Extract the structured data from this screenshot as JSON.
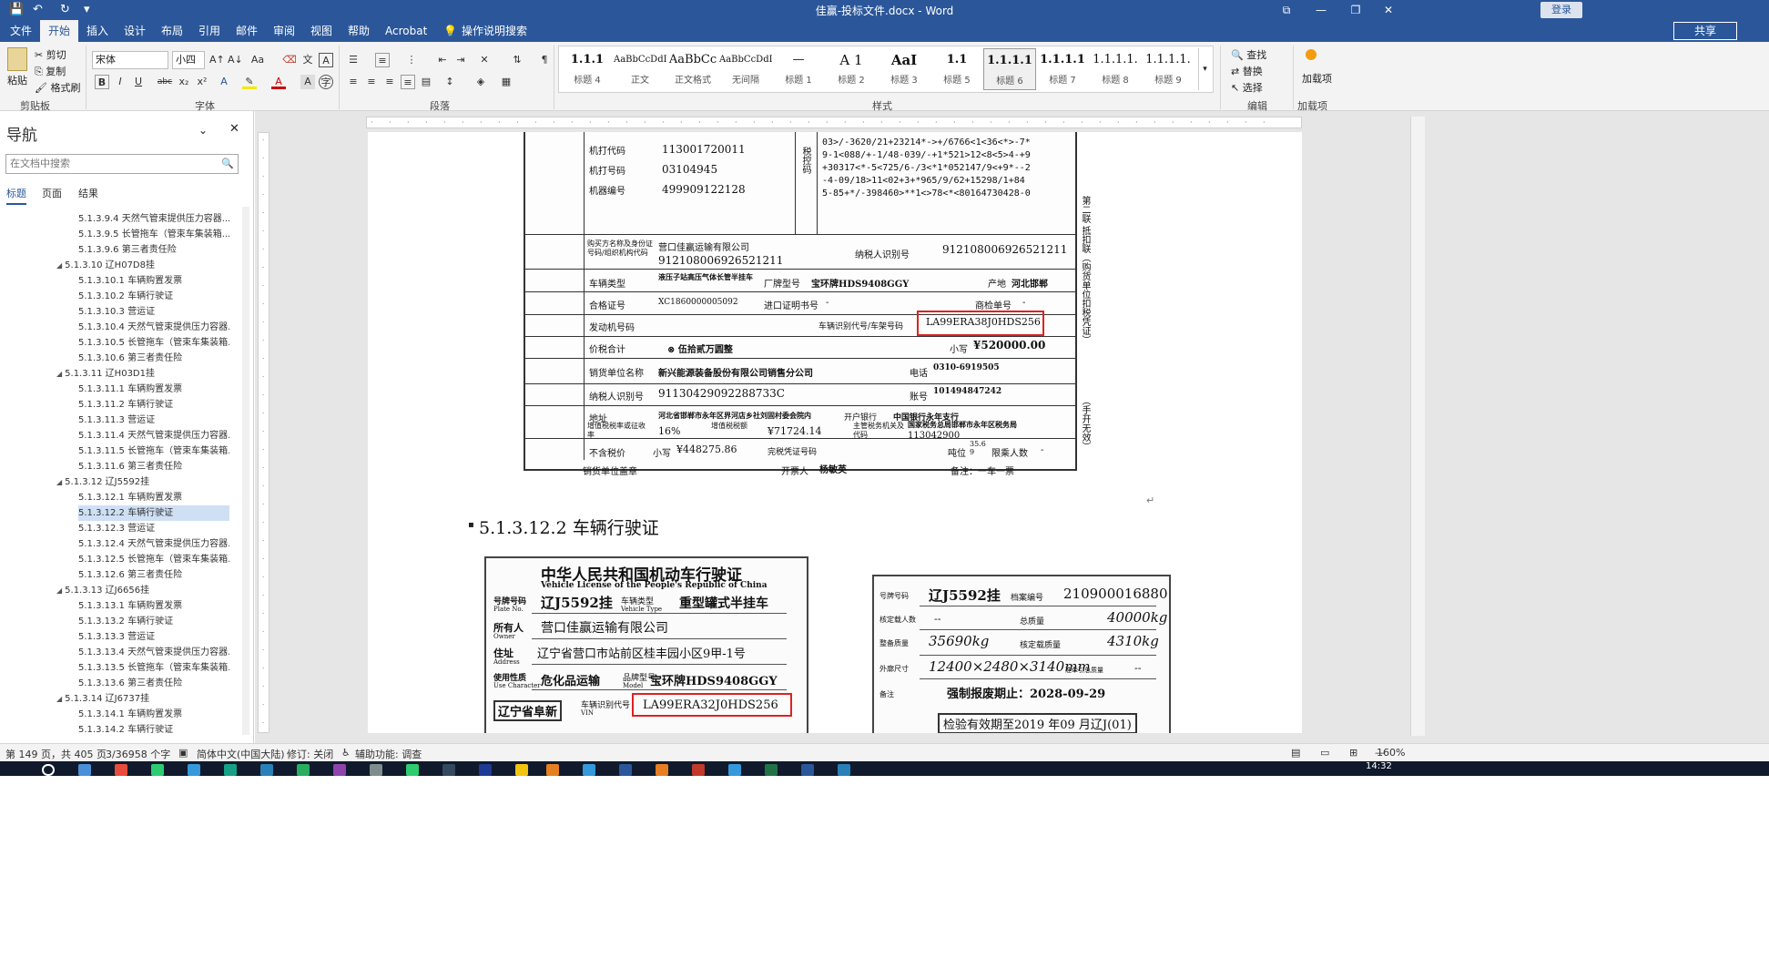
{
  "window": {
    "title": "佳赢-投标文件.docx - Word",
    "login": "登录",
    "controls": {
      "ribbon_display": "⧉",
      "minimize": "—",
      "restore": "❐",
      "close": "✕"
    },
    "quick_access": [
      "💾",
      "↶",
      "↻",
      "▾"
    ]
  },
  "tabs": [
    "文件",
    "开始",
    "插入",
    "设计",
    "布局",
    "引用",
    "邮件",
    "审阅",
    "视图",
    "帮助",
    "Acrobat",
    "操作说明搜索"
  ],
  "active_tab": "开始",
  "share": "共享",
  "ribbon": {
    "clipboard": {
      "paste": "粘贴",
      "cut": "剪切",
      "copy": "复制",
      "format_painter": "格式刷",
      "label": "剪贴板"
    },
    "font": {
      "name": "宋体",
      "size": "小四",
      "label": "字体",
      "bold": "B",
      "italic": "I",
      "underline": "U",
      "strike": "abc",
      "subscript": "x₂",
      "superscript": "x²"
    },
    "paragraph": {
      "label": "段落"
    },
    "styles": {
      "label": "样式",
      "items": [
        {
          "sample": "1.1.1",
          "name": "标题 4"
        },
        {
          "sample": "AaBbCcDdI",
          "name": "正文"
        },
        {
          "sample": "AaBbCc",
          "name": "正文格式"
        },
        {
          "sample": "AaBbCcDdI",
          "name": "无间隔"
        },
        {
          "sample": "—",
          "name": "标题 1"
        },
        {
          "sample": "A 1",
          "name": "标题 2"
        },
        {
          "sample": "AaI",
          "name": "标题 3"
        },
        {
          "sample": "1.1",
          "name": "标题 5"
        },
        {
          "sample": "1.1.1.1",
          "name": "标题 6"
        },
        {
          "sample": "1.1.1.1",
          "name": "标题 7"
        },
        {
          "sample": "1.1.1.1.",
          "name": "标题 8"
        },
        {
          "sample": "1.1.1.1.",
          "name": "标题 9"
        }
      ]
    },
    "editing": {
      "find": "查找",
      "replace": "替换",
      "select": "选择",
      "label": "编辑"
    },
    "addins": {
      "button": "加载项",
      "label": "加载项"
    }
  },
  "nav": {
    "title": "导航",
    "search_placeholder": "在文档中搜索",
    "tabs": [
      "标题",
      "页面",
      "结果"
    ],
    "items": [
      {
        "text": "5.1.3.9.4 天然气管束提供压力容器...",
        "level": 2
      },
      {
        "text": "5.1.3.9.5 长管拖车（管束车集装箱...",
        "level": 2
      },
      {
        "text": "5.1.3.9.6 第三者责任险",
        "level": 2
      },
      {
        "text": "5.1.3.10 辽H07D8挂",
        "level": 1
      },
      {
        "text": "5.1.3.10.1 车辆购置发票",
        "level": 2
      },
      {
        "text": "5.1.3.10.2 车辆行驶证",
        "level": 2
      },
      {
        "text": "5.1.3.10.3 营运证",
        "level": 2
      },
      {
        "text": "5.1.3.10.4 天然气管束提供压力容器...",
        "level": 2
      },
      {
        "text": "5.1.3.10.5 长管拖车（管束车集装箱...",
        "level": 2
      },
      {
        "text": "5.1.3.10.6 第三者责任险",
        "level": 2
      },
      {
        "text": "5.1.3.11 辽H03D1挂",
        "level": 1
      },
      {
        "text": "5.1.3.11.1 车辆购置发票",
        "level": 2
      },
      {
        "text": "5.1.3.11.2 车辆行驶证",
        "level": 2
      },
      {
        "text": "5.1.3.11.3 营运证",
        "level": 2
      },
      {
        "text": "5.1.3.11.4 天然气管束提供压力容器...",
        "level": 2
      },
      {
        "text": "5.1.3.11.5 长管拖车（管束车集装箱...",
        "level": 2
      },
      {
        "text": "5.1.3.11.6 第三者责任险",
        "level": 2
      },
      {
        "text": "5.1.3.12 辽J5592挂",
        "level": 1
      },
      {
        "text": "5.1.3.12.1 车辆购置发票",
        "level": 2
      },
      {
        "text": "5.1.3.12.2 车辆行驶证",
        "level": 2,
        "selected": true
      },
      {
        "text": "5.1.3.12.3 营运证",
        "level": 2
      },
      {
        "text": "5.1.3.12.4 天然气管束提供压力容器...",
        "level": 2
      },
      {
        "text": "5.1.3.12.5 长管拖车（管束车集装箱...",
        "level": 2
      },
      {
        "text": "5.1.3.12.6 第三者责任险",
        "level": 2
      },
      {
        "text": "5.1.3.13 辽J6656挂",
        "level": 1
      },
      {
        "text": "5.1.3.13.1 车辆购置发票",
        "level": 2
      },
      {
        "text": "5.1.3.13.2 车辆行驶证",
        "level": 2
      },
      {
        "text": "5.1.3.13.3 营运证",
        "level": 2
      },
      {
        "text": "5.1.3.13.4 天然气管束提供压力容器...",
        "level": 2
      },
      {
        "text": "5.1.3.13.5 长管拖车（管束车集装箱...",
        "level": 2
      },
      {
        "text": "5.1.3.13.6 第三者责任险",
        "level": 2
      },
      {
        "text": "5.1.3.14 辽J6737挂",
        "level": 1
      },
      {
        "text": "5.1.3.14.1 车辆购置发票",
        "level": 2
      },
      {
        "text": "5.1.3.14.2 车辆行驶证",
        "level": 2
      }
    ]
  },
  "invoice": {
    "machine_code_label": "机打代码",
    "machine_code": "113001720011",
    "machine_no_label": "机打号码",
    "machine_no": "03104945",
    "machine_id_label": "机器编号",
    "machine_id": "499909122128",
    "tax_code_label": "税控码",
    "tax_code_lines": [
      "03>/-3620/21+23214*->+/6766<1<36<*>-7*",
      "9-1<088/+-1/48-039/-+1*521>12<8<5>4-+9",
      "+30317<*-5<725/6-/3<*1*052147/9<+9*--2",
      "-4-09/18>11<02+3+*965/9/62+15298/1+84",
      "5-85+*/-398460>**1<>78<*<80164730428-0"
    ],
    "buyer_label": "购买方名称及身份证号码/组织机构代码",
    "buyer_name": "营口佳赢运输有限公司",
    "buyer_id": "912108006926521211",
    "taxpayer_id_label": "纳税人识别号",
    "taxpayer_id": "912108006926521211",
    "vehicle_type_label": "车辆类型",
    "vehicle_type": "液压子站高压气体长管半挂车",
    "brand_label": "厂牌型号",
    "brand_model": "宝环牌HDS9408GGY",
    "origin_label": "产地",
    "origin": "河北邯郸",
    "cert_label": "合格证号",
    "cert_no": "XC1860000005092",
    "import_label": "进口证明书号",
    "import_no": "-",
    "inspection_label": "商检单号",
    "inspection_no": "-",
    "engine_label": "发动机号码",
    "vin_label": "车辆识别代号/车架号码",
    "vin": "LA99ERA38J0HDS256",
    "total_label": "价税合计",
    "total_words": "⊗ 伍拾贰万圆整",
    "total_small_label": "小写",
    "total_small": "¥520000.00",
    "seller_label": "销货单位名称",
    "seller": "新兴能源装备股份有限公司销售分公司",
    "phone_label": "电话",
    "phone": "0310-6919505",
    "seller_tax_label": "纳税人识别号",
    "seller_tax": "91130429092288733C",
    "account_label": "账号",
    "account": "101494847242",
    "address_label": "地址",
    "address": "河北省邯郸市永年区界河店乡社刘固村委会院内",
    "bank_label": "开户银行",
    "bank": "中国银行永年支行",
    "vat_rate_label": "增值税税率或征收率",
    "vat_rate": "16%",
    "vat_amount_label": "增值税税额",
    "vat_amount": "¥71724.14",
    "tax_office_label": "主管税务机关及代码",
    "tax_office": "国家税务总局邯郸市永年区税务局",
    "tax_office_code": "113042900",
    "excl_label": "不含税价",
    "excl_small_label": "小写",
    "excl": "¥448275.86",
    "duty_label": "完税凭证号码",
    "tonnage_label": "吨位",
    "tonnage": "35.6 9",
    "passengers_label": "限乘人数",
    "passengers": "-",
    "footer_seller": "销货单位盖章",
    "footer_issuer": "开票人",
    "issuer": "杨敏英",
    "footer_note": "备注：一车一票",
    "side_note": "第二联 抵扣联（购货单位扣税凭证）",
    "side_note2": "（手开无效）"
  },
  "heading": "5.1.3.12.2 车辆行驶证",
  "license_front": {
    "title": "中华人民共和国机动车行驶证",
    "subtitle": "Vehicle License of the People's Republic of China",
    "plate_label": "号牌号码",
    "plate_en": "Plate No.",
    "plate": "辽J5592挂",
    "type_label": "车辆类型",
    "type_en": "Vehicle Type",
    "type": "重型罐式半挂车",
    "owner_label": "所有人",
    "owner_en": "Owner",
    "owner": "营口佳赢运输有限公司",
    "address_label": "住址",
    "address_en": "Address",
    "address": "辽宁省营口市站前区桂丰园小区9甲-1号",
    "use_label": "使用性质",
    "use_en": "Use Character",
    "use": "危化品运输",
    "model_label": "品牌型号",
    "model_en": "Model",
    "model": "宝环牌HDS9408GGY",
    "issuer": "辽宁省阜新",
    "vin_label": "车辆识别代号",
    "vin_en": "VIN",
    "vin": "LA99ERA32J0HDS256"
  },
  "license_back": {
    "plate_label": "号牌号码",
    "plate": "辽J5592挂",
    "file_label": "档案编号",
    "file_no": "210900016880",
    "capacity_label": "核定载人数",
    "capacity": "--",
    "total_label": "总质量",
    "total_mass": "40000kg",
    "curb_label": "整备质量",
    "curb": "35690kg",
    "load_label": "核定载质量",
    "load": "4310kg",
    "dims_label": "外廓尺寸",
    "dims": "12400×2480×3140mm",
    "tow_label": "准牵引总质量",
    "tow": "--",
    "scrap": "强制报废期止：2028-09-29",
    "note_label": "备注",
    "inspection": "检验有效期至2019 年09 月辽J(01)"
  },
  "status": {
    "page": "第 149 页，共 405 页",
    "words": "3/36958 个字",
    "lang": "简体中文(中国大陆)",
    "track": "修订: 关闭",
    "access": "辅助功能: 调查",
    "zoom": "160%"
  },
  "taskbar": {
    "clock": "14:32"
  },
  "colors": {
    "accent": "#2b579a",
    "highlight": "#d22222"
  }
}
